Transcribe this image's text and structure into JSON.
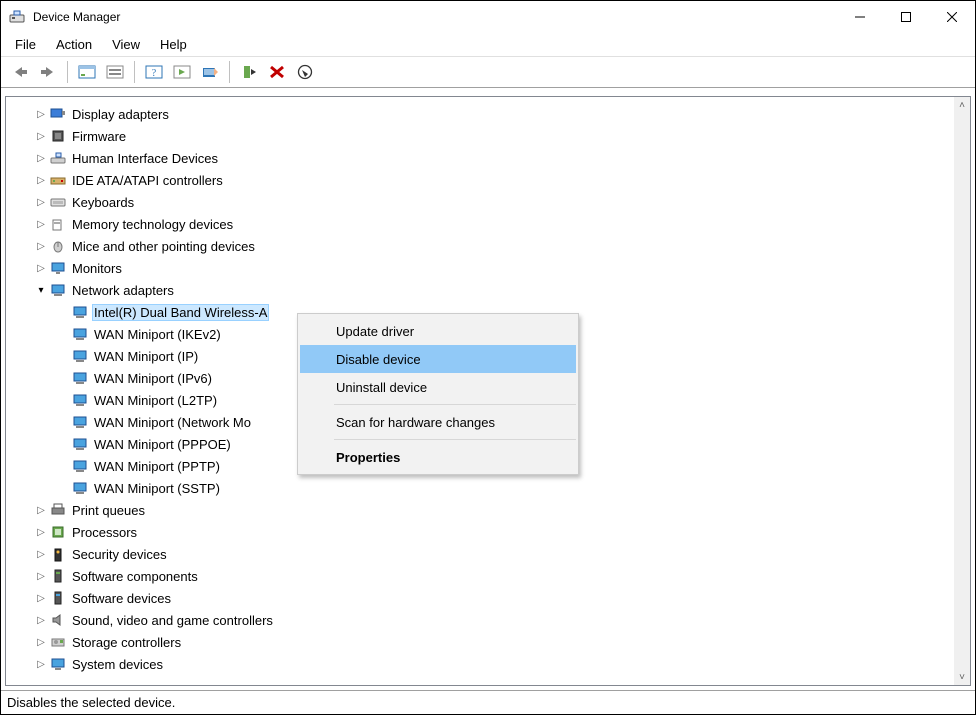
{
  "window": {
    "title": "Device Manager"
  },
  "menubar": {
    "file": "File",
    "action": "Action",
    "view": "View",
    "help": "Help"
  },
  "status": {
    "text": "Disables the selected device."
  },
  "context_menu": {
    "update": "Update driver",
    "disable": "Disable device",
    "uninstall": "Uninstall device",
    "scan": "Scan for hardware changes",
    "props": "Properties"
  },
  "tree": {
    "display": "Display adapters",
    "firmware": "Firmware",
    "hid": "Human Interface Devices",
    "ide": "IDE ATA/ATAPI controllers",
    "keyboards": "Keyboards",
    "memtech": "Memory technology devices",
    "mice": "Mice and other pointing devices",
    "monitors": "Monitors",
    "net": "Network adapters",
    "printq": "Print queues",
    "processors": "Processors",
    "security": "Security devices",
    "swcomp": "Software components",
    "swdev": "Software devices",
    "sound": "Sound, video and game controllers",
    "storage": "Storage controllers",
    "system": "System devices"
  },
  "net_children": {
    "intel": "Intel(R) Dual Band Wireless-A",
    "ikev2": "WAN Miniport (IKEv2)",
    "ip": "WAN Miniport (IP)",
    "ipv6": "WAN Miniport (IPv6)",
    "l2tp": "WAN Miniport (L2TP)",
    "netmon": "WAN Miniport (Network Mo",
    "pppoe": "WAN Miniport (PPPOE)",
    "pptp": "WAN Miniport (PPTP)",
    "sstp": "WAN Miniport (SSTP)"
  }
}
